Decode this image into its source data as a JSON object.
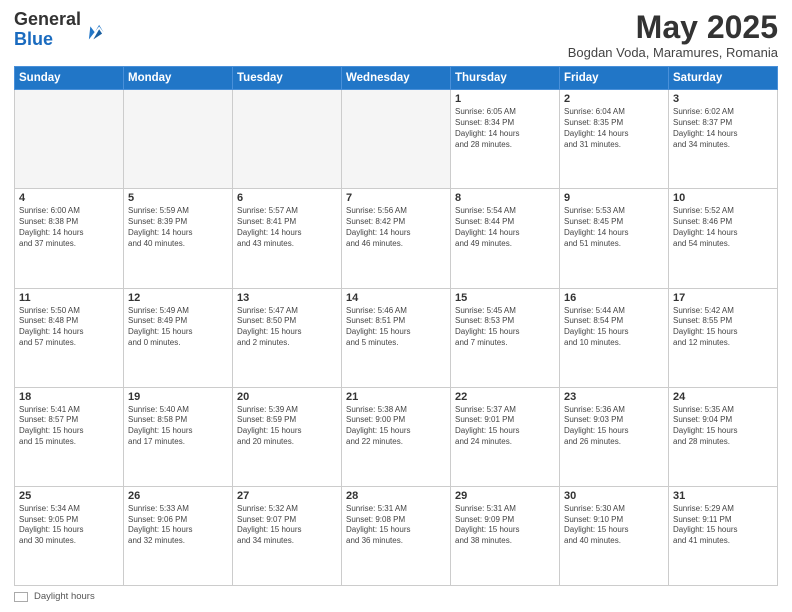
{
  "logo": {
    "line1": "General",
    "line2": "Blue"
  },
  "header": {
    "month": "May 2025",
    "location": "Bogdan Voda, Maramures, Romania"
  },
  "weekdays": [
    "Sunday",
    "Monday",
    "Tuesday",
    "Wednesday",
    "Thursday",
    "Friday",
    "Saturday"
  ],
  "weeks": [
    [
      {
        "day": "",
        "info": ""
      },
      {
        "day": "",
        "info": ""
      },
      {
        "day": "",
        "info": ""
      },
      {
        "day": "",
        "info": ""
      },
      {
        "day": "1",
        "info": "Sunrise: 6:05 AM\nSunset: 8:34 PM\nDaylight: 14 hours\nand 28 minutes."
      },
      {
        "day": "2",
        "info": "Sunrise: 6:04 AM\nSunset: 8:35 PM\nDaylight: 14 hours\nand 31 minutes."
      },
      {
        "day": "3",
        "info": "Sunrise: 6:02 AM\nSunset: 8:37 PM\nDaylight: 14 hours\nand 34 minutes."
      }
    ],
    [
      {
        "day": "4",
        "info": "Sunrise: 6:00 AM\nSunset: 8:38 PM\nDaylight: 14 hours\nand 37 minutes."
      },
      {
        "day": "5",
        "info": "Sunrise: 5:59 AM\nSunset: 8:39 PM\nDaylight: 14 hours\nand 40 minutes."
      },
      {
        "day": "6",
        "info": "Sunrise: 5:57 AM\nSunset: 8:41 PM\nDaylight: 14 hours\nand 43 minutes."
      },
      {
        "day": "7",
        "info": "Sunrise: 5:56 AM\nSunset: 8:42 PM\nDaylight: 14 hours\nand 46 minutes."
      },
      {
        "day": "8",
        "info": "Sunrise: 5:54 AM\nSunset: 8:44 PM\nDaylight: 14 hours\nand 49 minutes."
      },
      {
        "day": "9",
        "info": "Sunrise: 5:53 AM\nSunset: 8:45 PM\nDaylight: 14 hours\nand 51 minutes."
      },
      {
        "day": "10",
        "info": "Sunrise: 5:52 AM\nSunset: 8:46 PM\nDaylight: 14 hours\nand 54 minutes."
      }
    ],
    [
      {
        "day": "11",
        "info": "Sunrise: 5:50 AM\nSunset: 8:48 PM\nDaylight: 14 hours\nand 57 minutes."
      },
      {
        "day": "12",
        "info": "Sunrise: 5:49 AM\nSunset: 8:49 PM\nDaylight: 15 hours\nand 0 minutes."
      },
      {
        "day": "13",
        "info": "Sunrise: 5:47 AM\nSunset: 8:50 PM\nDaylight: 15 hours\nand 2 minutes."
      },
      {
        "day": "14",
        "info": "Sunrise: 5:46 AM\nSunset: 8:51 PM\nDaylight: 15 hours\nand 5 minutes."
      },
      {
        "day": "15",
        "info": "Sunrise: 5:45 AM\nSunset: 8:53 PM\nDaylight: 15 hours\nand 7 minutes."
      },
      {
        "day": "16",
        "info": "Sunrise: 5:44 AM\nSunset: 8:54 PM\nDaylight: 15 hours\nand 10 minutes."
      },
      {
        "day": "17",
        "info": "Sunrise: 5:42 AM\nSunset: 8:55 PM\nDaylight: 15 hours\nand 12 minutes."
      }
    ],
    [
      {
        "day": "18",
        "info": "Sunrise: 5:41 AM\nSunset: 8:57 PM\nDaylight: 15 hours\nand 15 minutes."
      },
      {
        "day": "19",
        "info": "Sunrise: 5:40 AM\nSunset: 8:58 PM\nDaylight: 15 hours\nand 17 minutes."
      },
      {
        "day": "20",
        "info": "Sunrise: 5:39 AM\nSunset: 8:59 PM\nDaylight: 15 hours\nand 20 minutes."
      },
      {
        "day": "21",
        "info": "Sunrise: 5:38 AM\nSunset: 9:00 PM\nDaylight: 15 hours\nand 22 minutes."
      },
      {
        "day": "22",
        "info": "Sunrise: 5:37 AM\nSunset: 9:01 PM\nDaylight: 15 hours\nand 24 minutes."
      },
      {
        "day": "23",
        "info": "Sunrise: 5:36 AM\nSunset: 9:03 PM\nDaylight: 15 hours\nand 26 minutes."
      },
      {
        "day": "24",
        "info": "Sunrise: 5:35 AM\nSunset: 9:04 PM\nDaylight: 15 hours\nand 28 minutes."
      }
    ],
    [
      {
        "day": "25",
        "info": "Sunrise: 5:34 AM\nSunset: 9:05 PM\nDaylight: 15 hours\nand 30 minutes."
      },
      {
        "day": "26",
        "info": "Sunrise: 5:33 AM\nSunset: 9:06 PM\nDaylight: 15 hours\nand 32 minutes."
      },
      {
        "day": "27",
        "info": "Sunrise: 5:32 AM\nSunset: 9:07 PM\nDaylight: 15 hours\nand 34 minutes."
      },
      {
        "day": "28",
        "info": "Sunrise: 5:31 AM\nSunset: 9:08 PM\nDaylight: 15 hours\nand 36 minutes."
      },
      {
        "day": "29",
        "info": "Sunrise: 5:31 AM\nSunset: 9:09 PM\nDaylight: 15 hours\nand 38 minutes."
      },
      {
        "day": "30",
        "info": "Sunrise: 5:30 AM\nSunset: 9:10 PM\nDaylight: 15 hours\nand 40 minutes."
      },
      {
        "day": "31",
        "info": "Sunrise: 5:29 AM\nSunset: 9:11 PM\nDaylight: 15 hours\nand 41 minutes."
      }
    ]
  ],
  "footer": {
    "label": "Daylight hours"
  }
}
